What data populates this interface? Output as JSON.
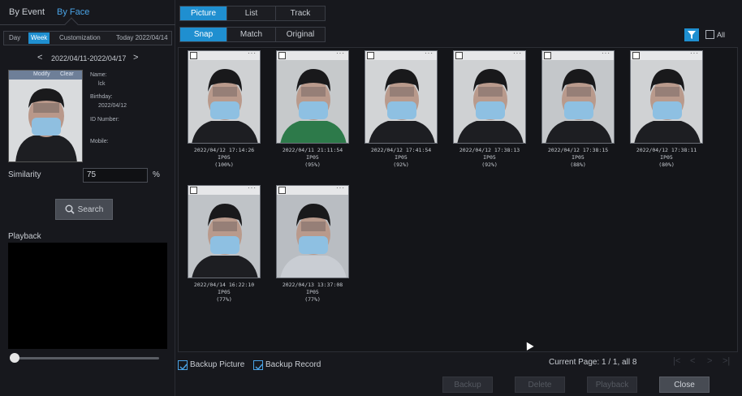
{
  "left_tabs": {
    "by_event": "By Event",
    "by_face": "By Face"
  },
  "range": {
    "day": "Day",
    "week": "Week",
    "custom": "Customization",
    "today": "Today 2022/04/14"
  },
  "datenav": {
    "prev": "<",
    "range": "2022/04/11-2022/04/17",
    "next": ">"
  },
  "face": {
    "modify": "Modify",
    "clear": "Clear",
    "name_label": "Name:",
    "name_value": "lck",
    "birthday_label": "Birthday:",
    "birthday_value": "2022/04/12",
    "id_label": "ID Number:",
    "mobile_label": "Mobile:"
  },
  "similarity": {
    "label": "Similarity",
    "value": "75",
    "unit": "%"
  },
  "search_label": "Search",
  "playback_label": "Playback",
  "view_tabs": [
    "Picture",
    "List",
    "Track"
  ],
  "sub_tabs": [
    "Snap",
    "Match",
    "Original"
  ],
  "all_label": "All",
  "results": [
    {
      "time": "2022/04/12 17:14:26",
      "channel": "IP05",
      "score": "(100%)"
    },
    {
      "time": "2022/04/11 21:11:54",
      "channel": "IP05",
      "score": "(95%)"
    },
    {
      "time": "2022/04/12 17:41:54",
      "channel": "IP05",
      "score": "(92%)"
    },
    {
      "time": "2022/04/12 17:38:13",
      "channel": "IP05",
      "score": "(92%)"
    },
    {
      "time": "2022/04/12 17:38:15",
      "channel": "IP05",
      "score": "(88%)"
    },
    {
      "time": "2022/04/12 17:38:11",
      "channel": "IP05",
      "score": "(80%)"
    },
    {
      "time": "2022/04/14 16:22:10",
      "channel": "IP05",
      "score": "(77%)"
    },
    {
      "time": "2022/04/13 13:37:08",
      "channel": "IP05",
      "score": "(77%)"
    }
  ],
  "bottom": {
    "backup_picture": "Backup Picture",
    "backup_record": "Backup Record",
    "page_info": "Current Page: 1 / 1, all 8"
  },
  "buttons": {
    "backup": "Backup",
    "delete": "Delete",
    "playback": "Playback",
    "close": "Close"
  },
  "colors": {
    "accent": "#1f8fd0",
    "background": "#17181d"
  },
  "icons": {
    "search": "magnifier-icon",
    "filter": "funnel-icon",
    "more": "ellipsis-icon"
  }
}
